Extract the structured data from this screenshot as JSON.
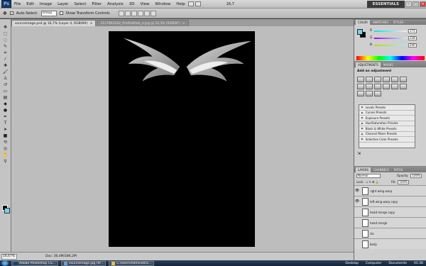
{
  "app": {
    "logo_text": "Ps",
    "workspace": "ESSENTIALS",
    "zoom_display": "16,7"
  },
  "menu": [
    "File",
    "Edit",
    "Image",
    "Layer",
    "Select",
    "Filter",
    "Analysis",
    "3D",
    "View",
    "Window",
    "Help"
  ],
  "options_bar": {
    "auto_select_label": "Auto-Select:",
    "auto_select_value": "Group",
    "show_transform_label": "Show Transform Controls"
  },
  "tabs": [
    {
      "label": "sourceimage.psd @ 16,7% (Layer 4, RGB/8#)",
      "active": true
    },
    {
      "label": "2127863162_ProfileWide_o.jpg @ 33,3% (RGB/8*)",
      "active": false
    }
  ],
  "status": {
    "zoom": "16,67%",
    "doc_size": "Doc: 36,4M/286,2M"
  },
  "color_panel": {
    "tabs": [
      "COLOR",
      "SWATCHES",
      "STYLES"
    ],
    "fg_color": "#7ecff0",
    "bg_color": "#000000",
    "r": "175",
    "g": "228",
    "b": "240"
  },
  "adjustments_panel": {
    "tabs": [
      "ADJUSTMENTS",
      "MASKS"
    ],
    "title": "Add an adjustment",
    "presets": [
      "Levels Presets",
      "Curves Presets",
      "Exposure Presets",
      "Hue/Saturation Presets",
      "Black & White Presets",
      "Channel Mixer Presets",
      "Selective Color Presets"
    ]
  },
  "layers_panel": {
    "tabs": [
      "LAYERS",
      "CHANNELS",
      "PATHS"
    ],
    "blend_mode": "Normal",
    "opacity_label": "Opacity:",
    "opacity": "100%",
    "lock_label": "Lock:",
    "fill_label": "Fill:",
    "fill": "100%",
    "layers": [
      {
        "name": "right wing warp",
        "visible": true
      },
      {
        "name": "left wing warp copy",
        "visible": true
      },
      {
        "name": "head merge copy",
        "visible": false
      },
      {
        "name": "head merge",
        "visible": false
      },
      {
        "name": "clo",
        "visible": false
      },
      {
        "name": "body",
        "visible": false
      }
    ]
  },
  "taskbar": {
    "items": [
      "Adobe Photoshop CS...",
      "sourceimage.jpg (IP...",
      "C:\\Users\\Administra..."
    ],
    "right_items": [
      "Desktop",
      "Computer",
      "Documents"
    ],
    "clock": "01:36"
  }
}
